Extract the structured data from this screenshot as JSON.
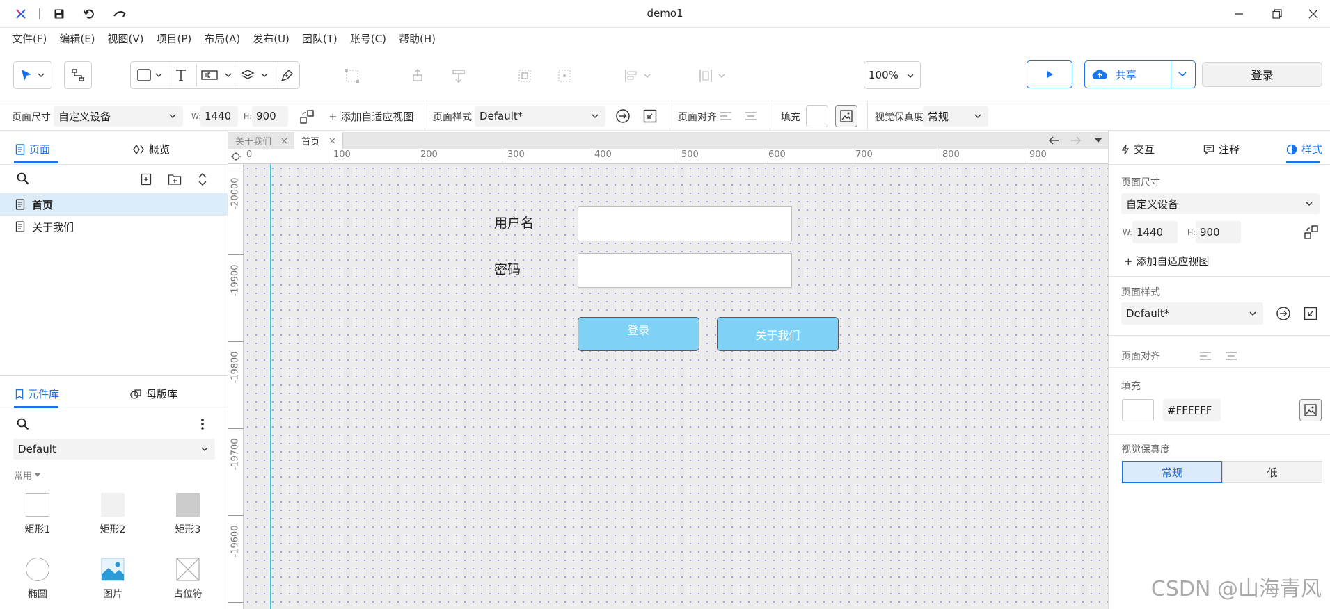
{
  "window": {
    "title": "demo1"
  },
  "menu": [
    {
      "label": "文件(F)"
    },
    {
      "label": "编辑(E)"
    },
    {
      "label": "视图(V)"
    },
    {
      "label": "项目(P)"
    },
    {
      "label": "布局(A)"
    },
    {
      "label": "发布(U)"
    },
    {
      "label": "团队(T)"
    },
    {
      "label": "账号(C)"
    },
    {
      "label": "帮助(H)"
    }
  ],
  "toolbar": {
    "zoom": "100%",
    "share_label": "共享",
    "login_label": "登录"
  },
  "propbar": {
    "page_size_label": "页面尺寸",
    "device": "自定义设备",
    "w_label": "W:",
    "w_value": "1440",
    "h_label": "H:",
    "h_value": "900",
    "add_view": "+ 添加自适应视图",
    "page_style_label": "页面样式",
    "page_style": "Default*",
    "page_align_label": "页面对齐",
    "fill_label": "填充",
    "fidelity_label": "视觉保真度",
    "fidelity_value": "常规"
  },
  "left": {
    "tabs": {
      "pages": "页面",
      "overview": "概览"
    },
    "pages": [
      {
        "label": "首页"
      },
      {
        "label": "关于我们"
      }
    ],
    "lib_tabs": {
      "components": "元件库",
      "masters": "母版库"
    },
    "library": "Default",
    "category": "常用",
    "components": [
      {
        "label": "矩形1"
      },
      {
        "label": "矩形2"
      },
      {
        "label": "矩形3"
      },
      {
        "label": "椭圆"
      },
      {
        "label": "图片"
      },
      {
        "label": "占位符"
      }
    ]
  },
  "doc_tabs": [
    {
      "label": "关于我们"
    },
    {
      "label": "首页"
    }
  ],
  "ruler": {
    "h": [
      "0",
      "100",
      "200",
      "300",
      "400",
      "500",
      "600",
      "700",
      "800",
      "900"
    ],
    "v": [
      "-20000",
      "-19900",
      "-19800",
      "-19700",
      "-19600"
    ]
  },
  "canvas": {
    "username_label": "用户名",
    "password_label": "密码",
    "login_button": "登录",
    "about_button": "关于我们"
  },
  "right": {
    "tabs": {
      "interact": "交互",
      "notes": "注释",
      "style": "样式"
    },
    "page_size_label": "页面尺寸",
    "device": "自定义设备",
    "w_label": "W:",
    "w_value": "1440",
    "h_label": "H:",
    "h_value": "900",
    "add_view": "+ 添加自适应视图",
    "page_style_label": "页面样式",
    "page_style": "Default*",
    "page_align_label": "页面对齐",
    "fill_label": "填充",
    "fill_value": "#FFFFFF",
    "fidelity_label": "视觉保真度",
    "fidelity_normal": "常规",
    "fidelity_low": "低"
  },
  "watermark": "CSDN @山海青风",
  "colors": {
    "accent": "#1a73e8",
    "button_fill": "#7fd2f6",
    "selected_row": "#dcedf9"
  }
}
